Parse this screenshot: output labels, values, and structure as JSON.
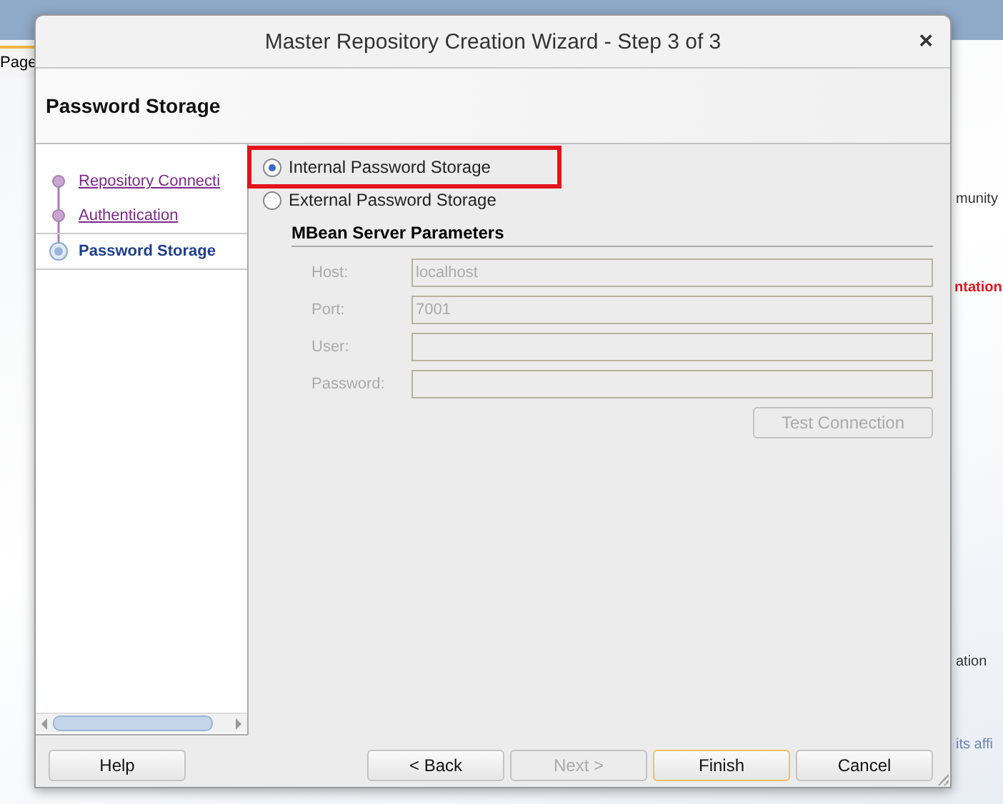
{
  "background": {
    "tab": "Page",
    "fragments": [
      {
        "text": "munity",
        "kind": "plain"
      },
      {
        "text": "ntation",
        "kind": "alert"
      },
      {
        "text": "ation",
        "kind": "plain"
      },
      {
        "text": "its affi",
        "kind": "link"
      }
    ]
  },
  "window": {
    "title": "Master Repository Creation Wizard - Step 3 of 3",
    "close": "×"
  },
  "header": {
    "title": "Password Storage"
  },
  "steps": [
    {
      "label": "Repository Connecti",
      "selected": false
    },
    {
      "label": "Authentication",
      "selected": false
    },
    {
      "label": "Password Storage",
      "selected": true
    }
  ],
  "options": [
    {
      "label": "Internal Password Storage",
      "selected": true,
      "highlighted": true
    },
    {
      "label": "External Password Storage",
      "selected": false,
      "highlighted": false
    }
  ],
  "section": {
    "title": "MBean Server Parameters",
    "disabled": true,
    "fields": [
      {
        "label": "Host:",
        "value": "localhost"
      },
      {
        "label": "Port:",
        "value": "7001"
      },
      {
        "label": "User:"
      },
      {
        "label": "Password:"
      }
    ],
    "test_button": "Test Connection"
  },
  "buttons": [
    {
      "label": "Help",
      "disabled": false,
      "default": false,
      "kind": "left"
    },
    {
      "label": "< Back",
      "disabled": false,
      "default": false,
      "kind": "right"
    },
    {
      "label": "Next >",
      "disabled": true,
      "default": false,
      "kind": "right"
    },
    {
      "label": "Finish",
      "disabled": false,
      "default": true,
      "kind": "right"
    },
    {
      "label": "Cancel",
      "disabled": false,
      "default": false,
      "kind": "right"
    }
  ]
}
